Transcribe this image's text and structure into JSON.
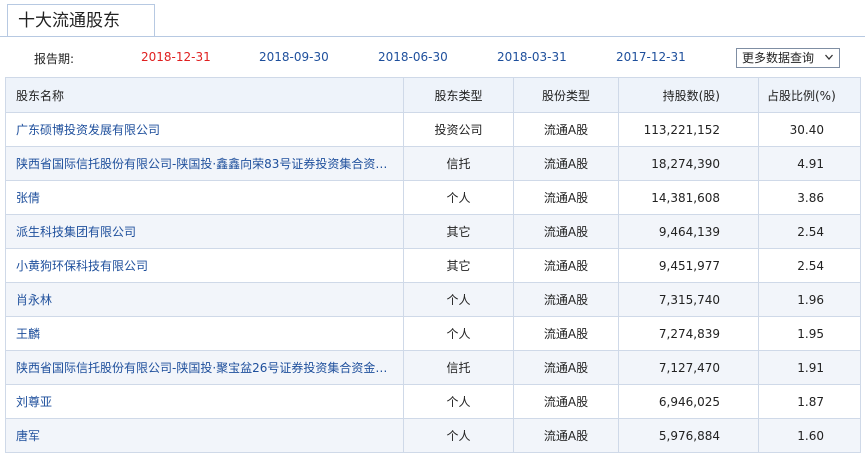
{
  "tab": {
    "title": "十大流通股东"
  },
  "report": {
    "label": "报告期:",
    "dates": [
      "2018-12-31",
      "2018-09-30",
      "2018-06-30",
      "2018-03-31",
      "2017-12-31"
    ],
    "active_index": 0,
    "query_label": "更多数据查询"
  },
  "colors": {
    "active_date": "#e02020",
    "link": "#1e4f9c",
    "header_bg": "#eef3fa",
    "alt_row_bg": "#f2f5fa"
  },
  "table": {
    "headers": [
      "股东名称",
      "股东类型",
      "股份类型",
      "持股数(股)",
      "占股比例(%)"
    ],
    "rows": [
      [
        "广东硕博投资发展有限公司",
        "投资公司",
        "流通A股",
        "113,221,152",
        "30.40"
      ],
      [
        "陕西省国际信托股份有限公司-陕国投·鑫鑫向荣83号证券投资集合资…",
        "信托",
        "流通A股",
        "18,274,390",
        "4.91"
      ],
      [
        "张倩",
        "个人",
        "流通A股",
        "14,381,608",
        "3.86"
      ],
      [
        "派生科技集团有限公司",
        "其它",
        "流通A股",
        "9,464,139",
        "2.54"
      ],
      [
        "小黄狗环保科技有限公司",
        "其它",
        "流通A股",
        "9,451,977",
        "2.54"
      ],
      [
        "肖永林",
        "个人",
        "流通A股",
        "7,315,740",
        "1.96"
      ],
      [
        "王麟",
        "个人",
        "流通A股",
        "7,274,839",
        "1.95"
      ],
      [
        "陕西省国际信托股份有限公司-陕国投·聚宝盆26号证券投资集合资金…",
        "信托",
        "流通A股",
        "7,127,470",
        "1.91"
      ],
      [
        "刘尊亚",
        "个人",
        "流通A股",
        "6,946,025",
        "1.87"
      ],
      [
        "唐军",
        "个人",
        "流通A股",
        "5,976,884",
        "1.60"
      ]
    ]
  }
}
